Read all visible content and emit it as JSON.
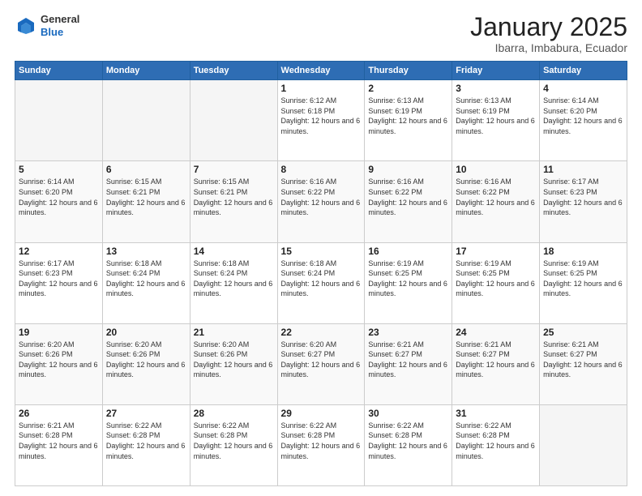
{
  "logo": {
    "general": "General",
    "blue": "Blue"
  },
  "header": {
    "month": "January 2025",
    "location": "Ibarra, Imbabura, Ecuador"
  },
  "weekdays": [
    "Sunday",
    "Monday",
    "Tuesday",
    "Wednesday",
    "Thursday",
    "Friday",
    "Saturday"
  ],
  "weeks": [
    [
      {
        "day": "",
        "sunrise": "",
        "sunset": "",
        "daylight": ""
      },
      {
        "day": "",
        "sunrise": "",
        "sunset": "",
        "daylight": ""
      },
      {
        "day": "",
        "sunrise": "",
        "sunset": "",
        "daylight": ""
      },
      {
        "day": "1",
        "sunrise": "Sunrise: 6:12 AM",
        "sunset": "Sunset: 6:18 PM",
        "daylight": "Daylight: 12 hours and 6 minutes."
      },
      {
        "day": "2",
        "sunrise": "Sunrise: 6:13 AM",
        "sunset": "Sunset: 6:19 PM",
        "daylight": "Daylight: 12 hours and 6 minutes."
      },
      {
        "day": "3",
        "sunrise": "Sunrise: 6:13 AM",
        "sunset": "Sunset: 6:19 PM",
        "daylight": "Daylight: 12 hours and 6 minutes."
      },
      {
        "day": "4",
        "sunrise": "Sunrise: 6:14 AM",
        "sunset": "Sunset: 6:20 PM",
        "daylight": "Daylight: 12 hours and 6 minutes."
      }
    ],
    [
      {
        "day": "5",
        "sunrise": "Sunrise: 6:14 AM",
        "sunset": "Sunset: 6:20 PM",
        "daylight": "Daylight: 12 hours and 6 minutes."
      },
      {
        "day": "6",
        "sunrise": "Sunrise: 6:15 AM",
        "sunset": "Sunset: 6:21 PM",
        "daylight": "Daylight: 12 hours and 6 minutes."
      },
      {
        "day": "7",
        "sunrise": "Sunrise: 6:15 AM",
        "sunset": "Sunset: 6:21 PM",
        "daylight": "Daylight: 12 hours and 6 minutes."
      },
      {
        "day": "8",
        "sunrise": "Sunrise: 6:16 AM",
        "sunset": "Sunset: 6:22 PM",
        "daylight": "Daylight: 12 hours and 6 minutes."
      },
      {
        "day": "9",
        "sunrise": "Sunrise: 6:16 AM",
        "sunset": "Sunset: 6:22 PM",
        "daylight": "Daylight: 12 hours and 6 minutes."
      },
      {
        "day": "10",
        "sunrise": "Sunrise: 6:16 AM",
        "sunset": "Sunset: 6:22 PM",
        "daylight": "Daylight: 12 hours and 6 minutes."
      },
      {
        "day": "11",
        "sunrise": "Sunrise: 6:17 AM",
        "sunset": "Sunset: 6:23 PM",
        "daylight": "Daylight: 12 hours and 6 minutes."
      }
    ],
    [
      {
        "day": "12",
        "sunrise": "Sunrise: 6:17 AM",
        "sunset": "Sunset: 6:23 PM",
        "daylight": "Daylight: 12 hours and 6 minutes."
      },
      {
        "day": "13",
        "sunrise": "Sunrise: 6:18 AM",
        "sunset": "Sunset: 6:24 PM",
        "daylight": "Daylight: 12 hours and 6 minutes."
      },
      {
        "day": "14",
        "sunrise": "Sunrise: 6:18 AM",
        "sunset": "Sunset: 6:24 PM",
        "daylight": "Daylight: 12 hours and 6 minutes."
      },
      {
        "day": "15",
        "sunrise": "Sunrise: 6:18 AM",
        "sunset": "Sunset: 6:24 PM",
        "daylight": "Daylight: 12 hours and 6 minutes."
      },
      {
        "day": "16",
        "sunrise": "Sunrise: 6:19 AM",
        "sunset": "Sunset: 6:25 PM",
        "daylight": "Daylight: 12 hours and 6 minutes."
      },
      {
        "day": "17",
        "sunrise": "Sunrise: 6:19 AM",
        "sunset": "Sunset: 6:25 PM",
        "daylight": "Daylight: 12 hours and 6 minutes."
      },
      {
        "day": "18",
        "sunrise": "Sunrise: 6:19 AM",
        "sunset": "Sunset: 6:25 PM",
        "daylight": "Daylight: 12 hours and 6 minutes."
      }
    ],
    [
      {
        "day": "19",
        "sunrise": "Sunrise: 6:20 AM",
        "sunset": "Sunset: 6:26 PM",
        "daylight": "Daylight: 12 hours and 6 minutes."
      },
      {
        "day": "20",
        "sunrise": "Sunrise: 6:20 AM",
        "sunset": "Sunset: 6:26 PM",
        "daylight": "Daylight: 12 hours and 6 minutes."
      },
      {
        "day": "21",
        "sunrise": "Sunrise: 6:20 AM",
        "sunset": "Sunset: 6:26 PM",
        "daylight": "Daylight: 12 hours and 6 minutes."
      },
      {
        "day": "22",
        "sunrise": "Sunrise: 6:20 AM",
        "sunset": "Sunset: 6:27 PM",
        "daylight": "Daylight: 12 hours and 6 minutes."
      },
      {
        "day": "23",
        "sunrise": "Sunrise: 6:21 AM",
        "sunset": "Sunset: 6:27 PM",
        "daylight": "Daylight: 12 hours and 6 minutes."
      },
      {
        "day": "24",
        "sunrise": "Sunrise: 6:21 AM",
        "sunset": "Sunset: 6:27 PM",
        "daylight": "Daylight: 12 hours and 6 minutes."
      },
      {
        "day": "25",
        "sunrise": "Sunrise: 6:21 AM",
        "sunset": "Sunset: 6:27 PM",
        "daylight": "Daylight: 12 hours and 6 minutes."
      }
    ],
    [
      {
        "day": "26",
        "sunrise": "Sunrise: 6:21 AM",
        "sunset": "Sunset: 6:28 PM",
        "daylight": "Daylight: 12 hours and 6 minutes."
      },
      {
        "day": "27",
        "sunrise": "Sunrise: 6:22 AM",
        "sunset": "Sunset: 6:28 PM",
        "daylight": "Daylight: 12 hours and 6 minutes."
      },
      {
        "day": "28",
        "sunrise": "Sunrise: 6:22 AM",
        "sunset": "Sunset: 6:28 PM",
        "daylight": "Daylight: 12 hours and 6 minutes."
      },
      {
        "day": "29",
        "sunrise": "Sunrise: 6:22 AM",
        "sunset": "Sunset: 6:28 PM",
        "daylight": "Daylight: 12 hours and 6 minutes."
      },
      {
        "day": "30",
        "sunrise": "Sunrise: 6:22 AM",
        "sunset": "Sunset: 6:28 PM",
        "daylight": "Daylight: 12 hours and 6 minutes."
      },
      {
        "day": "31",
        "sunrise": "Sunrise: 6:22 AM",
        "sunset": "Sunset: 6:28 PM",
        "daylight": "Daylight: 12 hours and 6 minutes."
      },
      {
        "day": "",
        "sunrise": "",
        "sunset": "",
        "daylight": ""
      }
    ]
  ]
}
